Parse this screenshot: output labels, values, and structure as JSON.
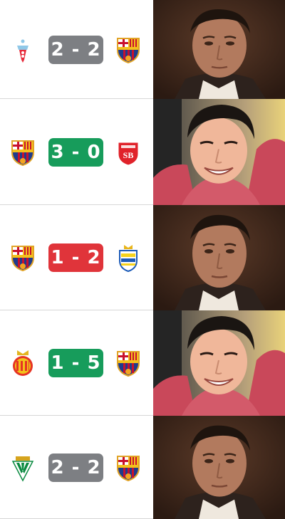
{
  "matches": [
    {
      "home_crest": "celta-crest-icon",
      "away_crest": "barcelona-crest-icon",
      "score": "2 - 2",
      "result": "draw",
      "photo": "serious-face"
    },
    {
      "home_crest": "barcelona-crest-icon",
      "away_crest": "brest-crest-icon",
      "score": "3 - 0",
      "result": "win",
      "photo": "smiling-face"
    },
    {
      "home_crest": "barcelona-crest-icon",
      "away_crest": "las-palmas-crest-icon",
      "score": "1 - 2",
      "result": "loss",
      "photo": "serious-face"
    },
    {
      "home_crest": "mallorca-crest-icon",
      "away_crest": "barcelona-crest-icon",
      "score": "1 - 5",
      "result": "win",
      "photo": "smiling-face"
    },
    {
      "home_crest": "betis-crest-icon",
      "away_crest": "barcelona-crest-icon",
      "score": "2 - 2",
      "result": "draw",
      "photo": "serious-face"
    }
  ],
  "colors": {
    "draw": "#7d7f83",
    "win": "#179c5b",
    "loss": "#e0343a"
  }
}
